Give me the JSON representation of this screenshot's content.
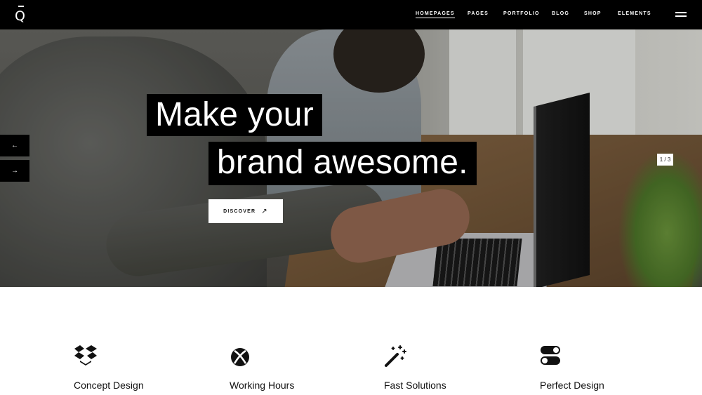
{
  "header": {
    "logo_letter": "Q",
    "nav": [
      {
        "label": "HOMEPAGES",
        "active": true
      },
      {
        "label": "PAGES",
        "active": false
      },
      {
        "label": "PORTFOLIO",
        "active": false
      },
      {
        "label": "BLOG",
        "active": false
      },
      {
        "label": "SHOP",
        "active": false
      },
      {
        "label": "ELEMENTS",
        "active": false
      }
    ],
    "menu_icon": "hamburger-icon"
  },
  "hero": {
    "headline_line1": "Make your",
    "headline_line2": "brand awesome.",
    "cta_label": "DISCOVER",
    "cta_icon": "arrow-up-right-icon",
    "prev_icon": "arrow-left-icon",
    "next_icon": "arrow-right-icon",
    "slide_counter": "1 / 3"
  },
  "features": [
    {
      "label": "Concept Design",
      "icon": "dropbox-icon"
    },
    {
      "label": "Working Hours",
      "icon": "xbox-icon"
    },
    {
      "label": "Fast Solutions",
      "icon": "magic-wand-icon"
    },
    {
      "label": "Perfect Design",
      "icon": "toggle-icon"
    }
  ],
  "colors": {
    "bar": "#000000",
    "text_light": "#ffffff",
    "text_dark": "#111111",
    "background": "#ffffff"
  }
}
